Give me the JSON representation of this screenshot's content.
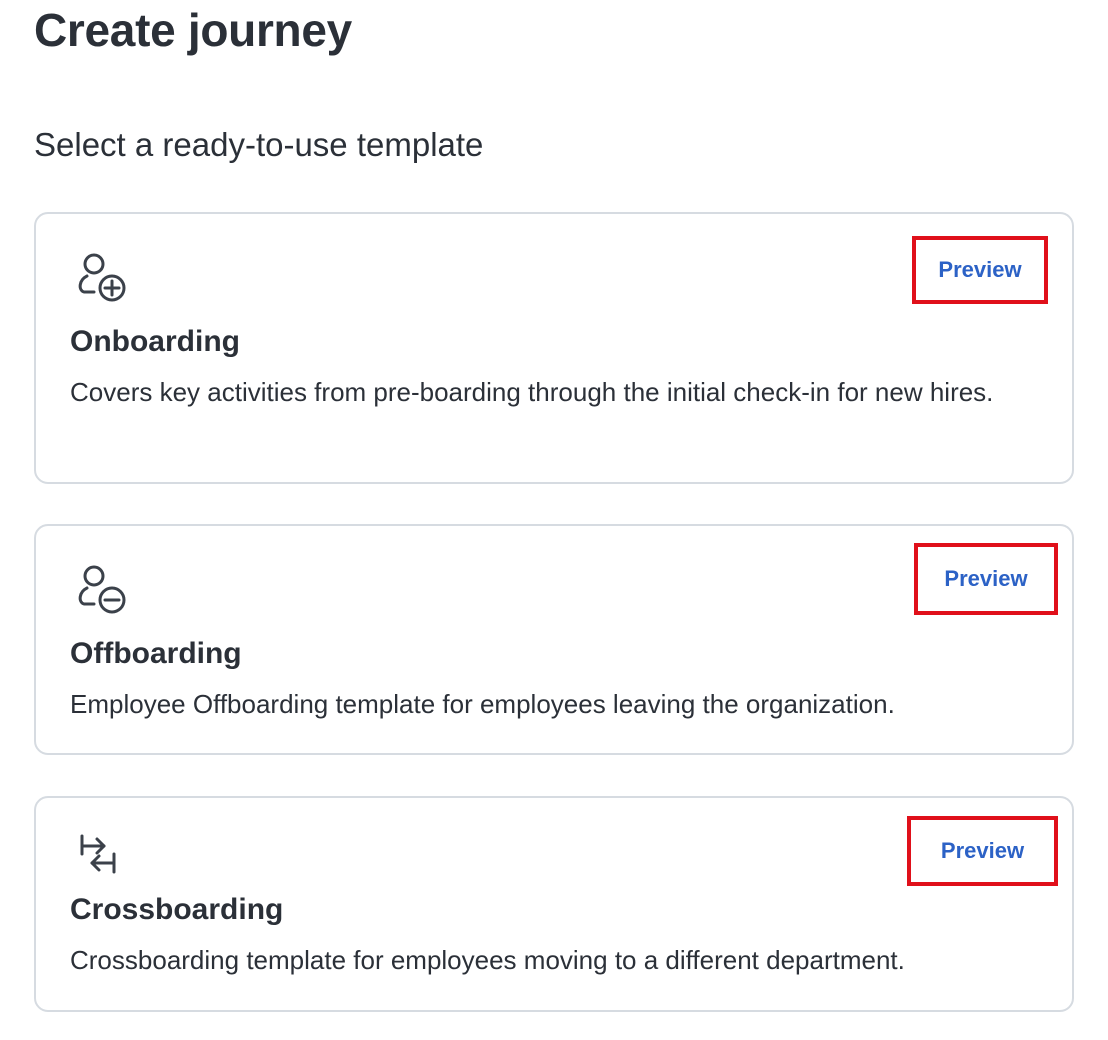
{
  "page": {
    "title": "Create journey",
    "subtitle": "Select a ready-to-use template"
  },
  "templates": [
    {
      "icon": "person-add-icon",
      "title": "Onboarding",
      "description": "Covers key activities from pre-boarding through the initial check-in for new hires.",
      "preview_label": "Preview"
    },
    {
      "icon": "person-remove-icon",
      "title": "Offboarding",
      "description": "Employee Offboarding template for employees leaving the organization.",
      "preview_label": "Preview"
    },
    {
      "icon": "transfer-arrows-icon",
      "title": "Crossboarding",
      "description": "Crossboarding template for employees moving to a different department.",
      "preview_label": "Preview"
    }
  ],
  "colors": {
    "text": "#2b3038",
    "link": "#2c62c6",
    "highlight_border": "#e0101a",
    "card_border": "#d6dbe1"
  }
}
